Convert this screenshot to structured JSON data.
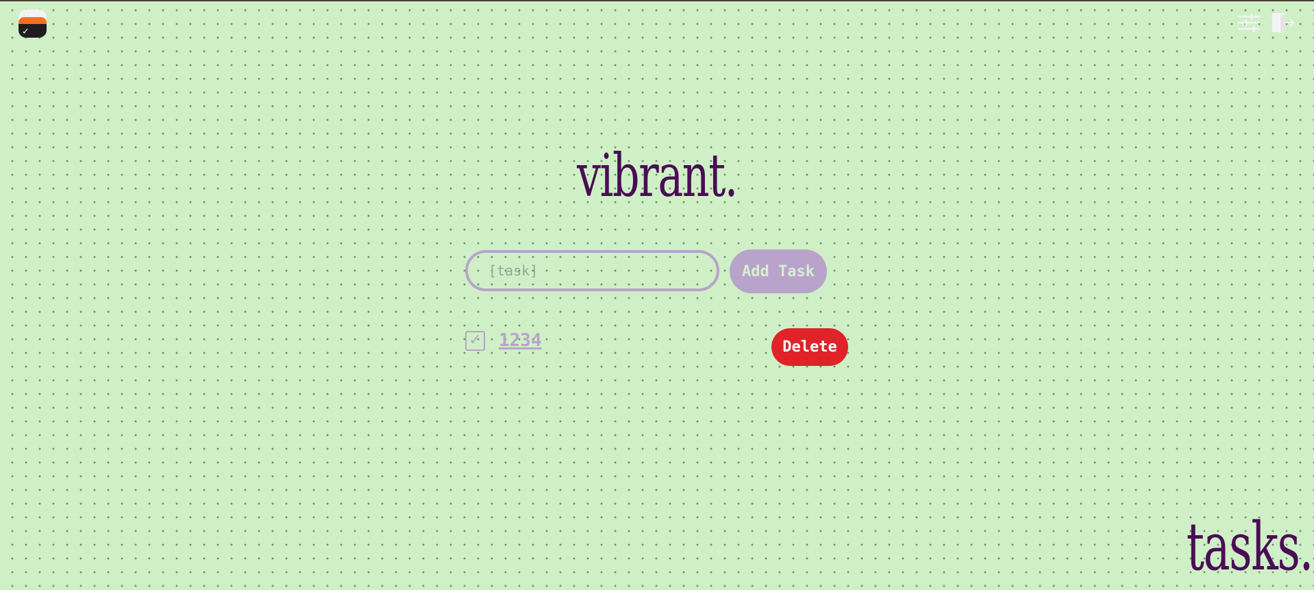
{
  "header": {
    "logo": {
      "icon": "check-card-logo-icon",
      "colors": {
        "top": "#f2f2f2",
        "middle": "#f36f21",
        "bottom": "#1f1d1e"
      }
    },
    "actions": [
      {
        "icon": "sliders-icon",
        "label": "settings"
      },
      {
        "icon": "logout-icon",
        "label": "logout"
      }
    ]
  },
  "main": {
    "title": "vibrant.",
    "task_input": {
      "placeholder": "[task]",
      "value": ""
    },
    "add_button_label": "Add Task",
    "tasks": [
      {
        "text": "1234",
        "completed": true,
        "delete_label": "Delete"
      }
    ]
  },
  "footer": {
    "title": "tasks."
  },
  "colors": {
    "background": "#cff0c6",
    "dots": "#6f8f72",
    "accent_purple": "#4a0d55",
    "lavender": "#b8a3cb",
    "delete_red": "#df2329"
  }
}
